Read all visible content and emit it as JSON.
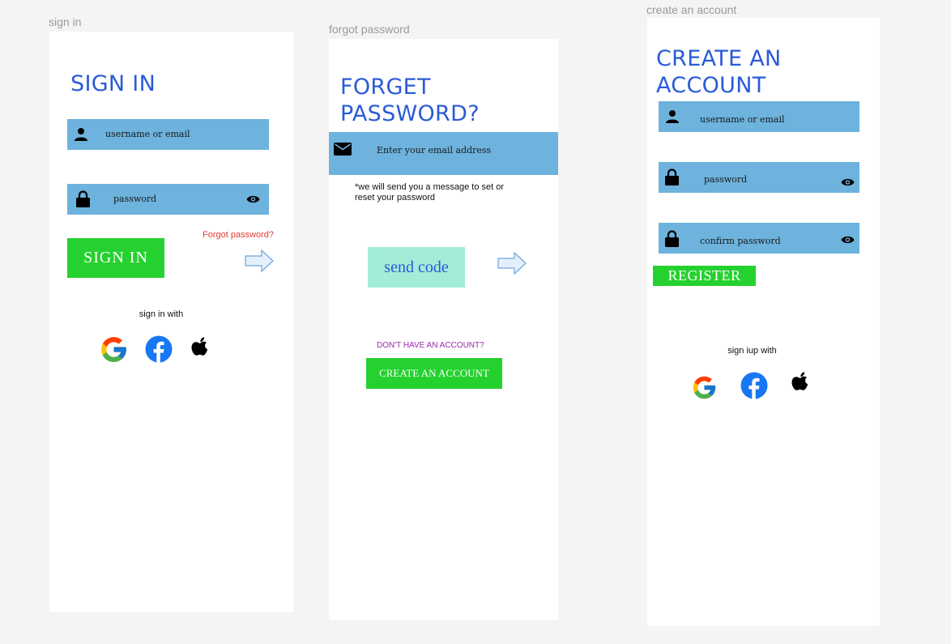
{
  "sign_in": {
    "frame_label": "sign in",
    "title": "SIGN IN",
    "username_placeholder": "username or email",
    "password_placeholder": "password",
    "forgot_link": "Forgot password?",
    "sign_in_button": "SIGN IN",
    "social_label": "sign in with"
  },
  "forgot_password": {
    "frame_label": "forgot password",
    "title_line1": "FORGET",
    "title_line2": "PASSWORD?",
    "email_placeholder": "Enter your email address",
    "note_line1": "*we will send you a message to set or",
    "note_line2": "reset your password",
    "send_code_button": "send code",
    "no_account_text": "DON'T HAVE AN ACCOUNT?",
    "create_account_button": "CREATE AN ACCOUNT"
  },
  "create_account": {
    "frame_label": "create an account",
    "title_line1": "CREATE AN",
    "title_line2": "ACCOUNT",
    "username_placeholder": "username or email",
    "password_placeholder": "password",
    "confirm_placeholder": "confirm password",
    "register_button": "REGISTER",
    "social_label": "sign iup with"
  },
  "icons": [
    "user-icon",
    "lock-icon",
    "eye-icon",
    "mail-icon",
    "arrow-right-icon",
    "google-icon",
    "facebook-icon",
    "apple-icon"
  ],
  "colors": {
    "title_blue": "#2a5bd6",
    "field_blue": "#6db3dd",
    "button_green": "#25d12f",
    "send_code_bg": "#a3ecd8",
    "forgot_red": "#e53935",
    "no_account_purple": "#9c27b0",
    "facebook_blue": "#1877f2"
  }
}
